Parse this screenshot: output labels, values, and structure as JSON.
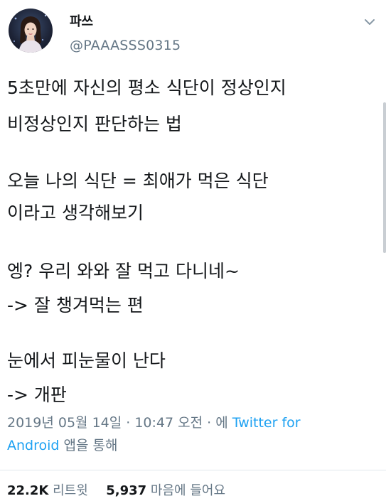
{
  "user": {
    "name": "파쓰",
    "handle": "@PAAASSS0315"
  },
  "tweet": {
    "lines": [
      "5초만에 자신의 평소 식단이 정상인지",
      "비정상인지 판단하는 법",
      "오늘 나의 식단 = 최애가 먹은 식단",
      "이라고 생각해보기",
      "엥? 우리 와와 잘 먹고 다니네~",
      "-> 잘 챙겨먹는 편",
      "눈에서 피눈물이 난다",
      "-> 개판"
    ]
  },
  "meta": {
    "timestamp": "2019년 05월 14일 · 10:47 오전 · 에",
    "source_part1": "Twitter for",
    "source_part2": "Android",
    "suffix": "앱을 통해"
  },
  "stats": {
    "retweets": "22.2K",
    "retweets_label": "리트윗",
    "likes": "5,937",
    "likes_label": "마음에 들어요"
  },
  "colors": {
    "link": "#1da1f2",
    "secondary": "#657786",
    "text": "#14171a"
  },
  "icons": {
    "caret": "chevron-down-icon"
  }
}
